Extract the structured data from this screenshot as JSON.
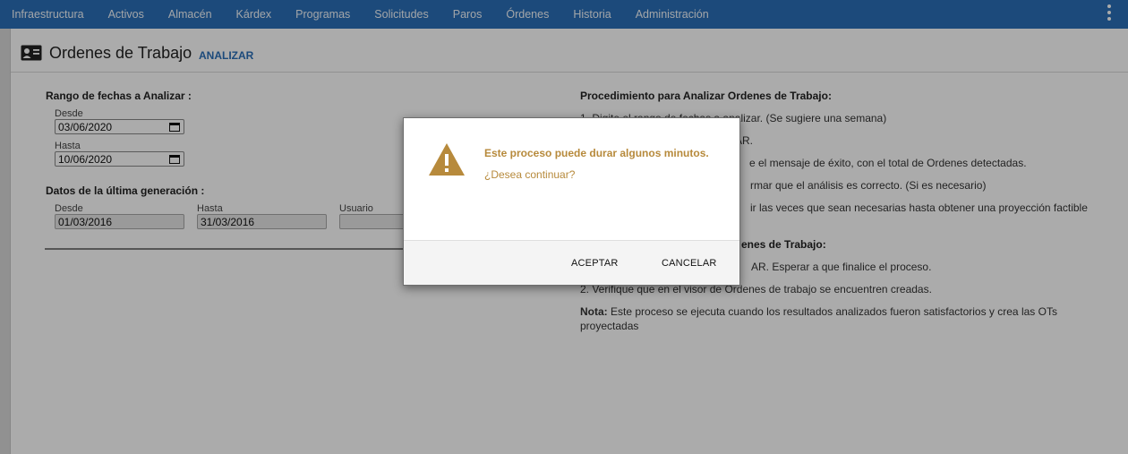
{
  "nav": {
    "items": [
      "Infraestructura",
      "Activos",
      "Almacén",
      "Kárdex",
      "Programas",
      "Solicitudes",
      "Paros",
      "Órdenes",
      "Historia",
      "Administración"
    ]
  },
  "header": {
    "title": "Ordenes de Trabajo",
    "action": "ANALIZAR"
  },
  "range": {
    "label": "Rango de fechas a Analizar :",
    "from_label": "Desde",
    "from_value": "03/06/2020",
    "to_label": "Hasta",
    "to_value": "10/06/2020"
  },
  "last": {
    "label": "Datos de la última generación :",
    "from_label": "Desde",
    "from_value": "01/03/2016",
    "to_label": "Hasta",
    "to_value": "31/03/2016",
    "user_label": "Usuario",
    "user_value": ""
  },
  "procedure": {
    "title": "Procedimiento para Analizar Ordenes de Trabajo:",
    "steps": [
      "1. Digite el rango de fechas a analizar. (Se sugiere una semana)",
      "AR.",
      "e el mensaje de éxito, con el total de Ordenes detectadas.",
      "rmar que el análisis es correcto. (Si es necesario)",
      "ir las veces que sean necesarias hasta obtener una proyección factible"
    ],
    "create_title": "enes de Trabajo:",
    "create_steps": [
      "AR. Esperar a que finalice el proceso.",
      "2. Verifique que en el visor de Ordenes de trabajo se encuentren creadas."
    ],
    "note_label": "Nota:",
    "note_line1": "Este proceso se ejecuta cuando los resultados analizados fueron satisfactorios y crea las OTs",
    "note_line2": "proyectadas"
  },
  "modal": {
    "message": "Este proceso puede durar algunos minutos.",
    "question": "¿Desea continuar?",
    "accept": "ACEPTAR",
    "cancel": "CANCELAR"
  },
  "icons": {
    "warning": "warning-icon",
    "card": "id-card-icon",
    "calendar": "calendar-icon",
    "menu": "kebab-menu-icon"
  },
  "colors": {
    "nav_bg": "#2a6fb8",
    "link": "#2a6fb8",
    "warning": "#b78a3c"
  }
}
